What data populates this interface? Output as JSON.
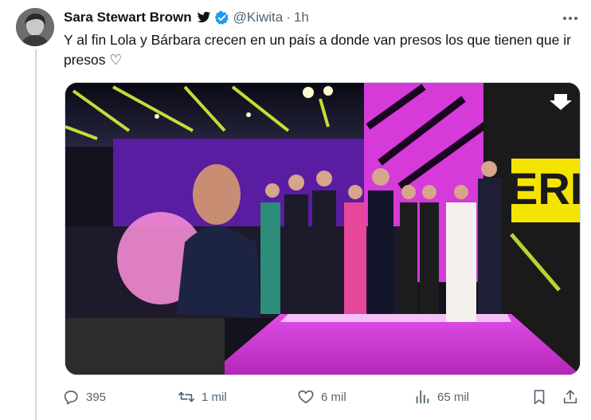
{
  "author": {
    "name": "Sara Stewart Brown",
    "handle": "@Kiwita",
    "separator": "·",
    "time": "1h"
  },
  "tweet": {
    "text": "Y al fin Lola y Bárbara crecen en un país a donde van presos los que tienen que ir presos ♡"
  },
  "media": {
    "type": "video",
    "stage_sign_text": "ERI",
    "icon": "download-arrow-icon"
  },
  "actions": {
    "replies": "395",
    "retweets": "1 mil",
    "likes": "6 mil",
    "views": "65 mil"
  },
  "colors": {
    "text": "#0f1419",
    "secondary": "#536471",
    "verified": "#1d9bf0",
    "stage_magenta": "#d63ad9",
    "stage_yellow": "#f5e400"
  }
}
